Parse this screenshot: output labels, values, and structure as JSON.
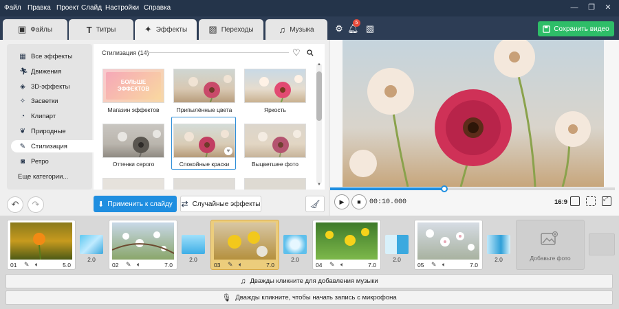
{
  "menu": [
    "Файл",
    "Правка",
    "Проект",
    "Слайд",
    "Настройки",
    "Справка"
  ],
  "tabs": [
    {
      "label": "Файлы",
      "icon": "files-icon"
    },
    {
      "label": "Титры",
      "icon": "text-icon"
    },
    {
      "label": "Эффекты",
      "icon": "effects-icon"
    },
    {
      "label": "Переходы",
      "icon": "transitions-icon"
    },
    {
      "label": "Музыка",
      "icon": "music-icon"
    }
  ],
  "toolbar": {
    "notifications_count": "5",
    "save_label": "Сохранить видео"
  },
  "categories": [
    {
      "label": "Все эффекты",
      "icon": "grid-icon"
    },
    {
      "label": "Движения",
      "icon": "motion-icon"
    },
    {
      "label": "3D-эффекты",
      "icon": "cube-icon"
    },
    {
      "label": "Засветки",
      "icon": "sparkle-icon"
    },
    {
      "label": "Клипарт",
      "icon": "clipart-icon"
    },
    {
      "label": "Природные",
      "icon": "leaf-icon"
    },
    {
      "label": "Стилизация",
      "icon": "brush-icon"
    },
    {
      "label": "Ретро",
      "icon": "camera-icon"
    },
    {
      "label": "Еще категории...",
      "icon": ""
    }
  ],
  "gallery": {
    "title": "Стилизация (14)",
    "promo_text": "БОЛЬШЕ ЭФФЕКТОВ",
    "items": [
      {
        "label": "Магазин эффектов"
      },
      {
        "label": "Припылённые цвета"
      },
      {
        "label": "Яркость"
      },
      {
        "label": "Оттенки серого"
      },
      {
        "label": "Спокойные краски"
      },
      {
        "label": "Выцветшее фото"
      }
    ],
    "selected_index": 4
  },
  "actions": {
    "apply_label": "Применить к слайду",
    "random_label": "Случайные эффекты"
  },
  "player": {
    "timecode": "00:10.000",
    "aspect": "16:9",
    "progress": 0.4
  },
  "slides": [
    {
      "num": "01",
      "duration": "5.0"
    },
    {
      "num": "02",
      "duration": "7.0"
    },
    {
      "num": "03",
      "duration": "7.0"
    },
    {
      "num": "04",
      "duration": "7.0"
    },
    {
      "num": "05",
      "duration": "7.0"
    }
  ],
  "transitions": [
    "2.0",
    "2.0",
    "2.0",
    "2.0",
    "2.0"
  ],
  "add_photo_label": "Добавьте фото",
  "tracks": {
    "music": "Дважды кликните для добавления музыки",
    "mic": "Дважды кликните, чтобы начать запись с микрофона"
  },
  "colors": {
    "titlebar": "#24344a",
    "accent": "#1f8ee0",
    "save": "#2ebd68",
    "selected_slide": "#eccd7c"
  }
}
